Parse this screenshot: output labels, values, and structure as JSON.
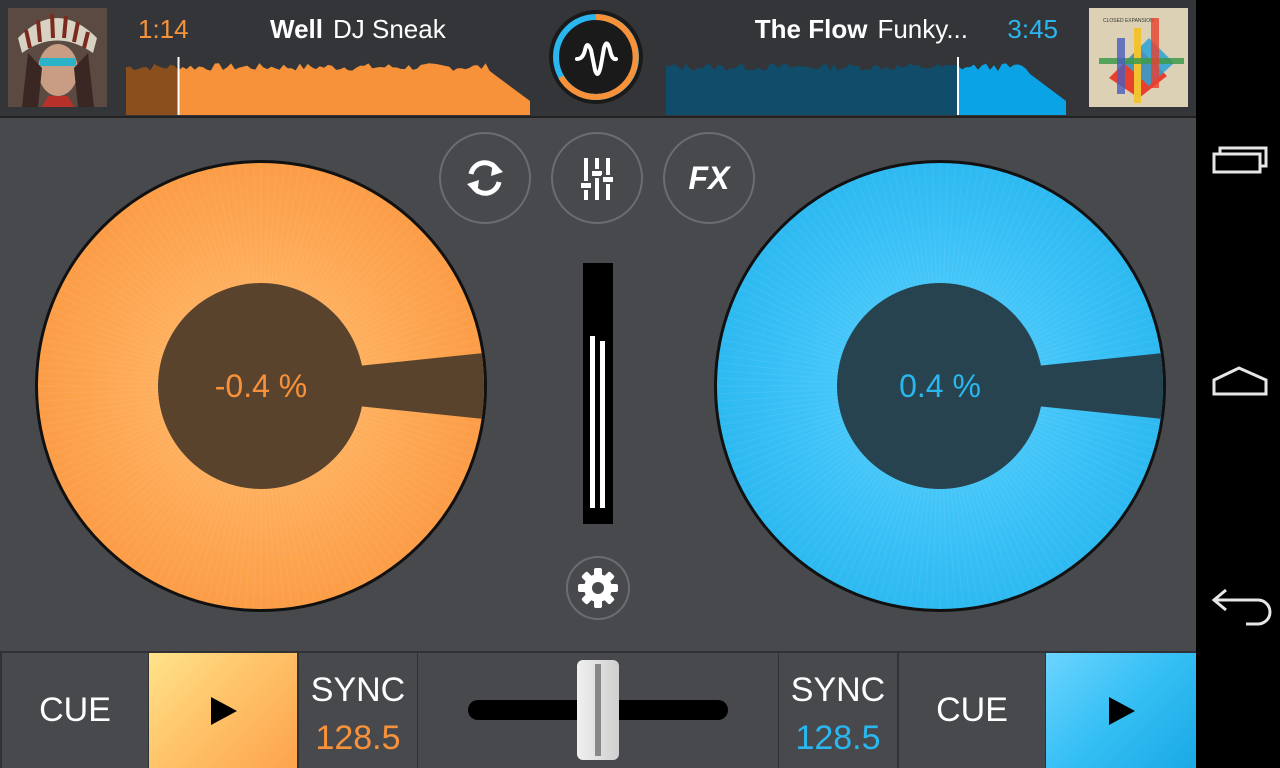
{
  "deck_a": {
    "time": "1:14",
    "title": "Well",
    "artist": "DJ Sneak",
    "pitch": "-0.4 %",
    "bpm": "128.5",
    "progress": 0.13,
    "color": "#f8923a",
    "cue_label": "CUE",
    "sync_label": "SYNC",
    "cover_icon": "album-art-headdress"
  },
  "deck_b": {
    "time": "3:45",
    "title": "The Flow",
    "artist": "Funky...",
    "pitch": "0.4 %",
    "bpm": "128.5",
    "progress": 0.73,
    "color": "#2ab6ee",
    "cue_label": "CUE",
    "sync_label": "SYNC",
    "cover_icon": "album-art-abstract",
    "cover_text": "CLOSED EXPANSION"
  },
  "center": {
    "fx_label": "FX",
    "vu_levels": [
      0.75,
      0.73
    ],
    "crossfader_position": 0.5
  },
  "icons": {
    "logo": "waveform-logo-icon",
    "loop": "loop-icon",
    "mixer": "mixer-sliders-icon",
    "settings": "gear-icon",
    "play": "play-icon",
    "nav_recent": "recent-apps-icon",
    "nav_home": "home-icon",
    "nav_back": "back-icon"
  }
}
